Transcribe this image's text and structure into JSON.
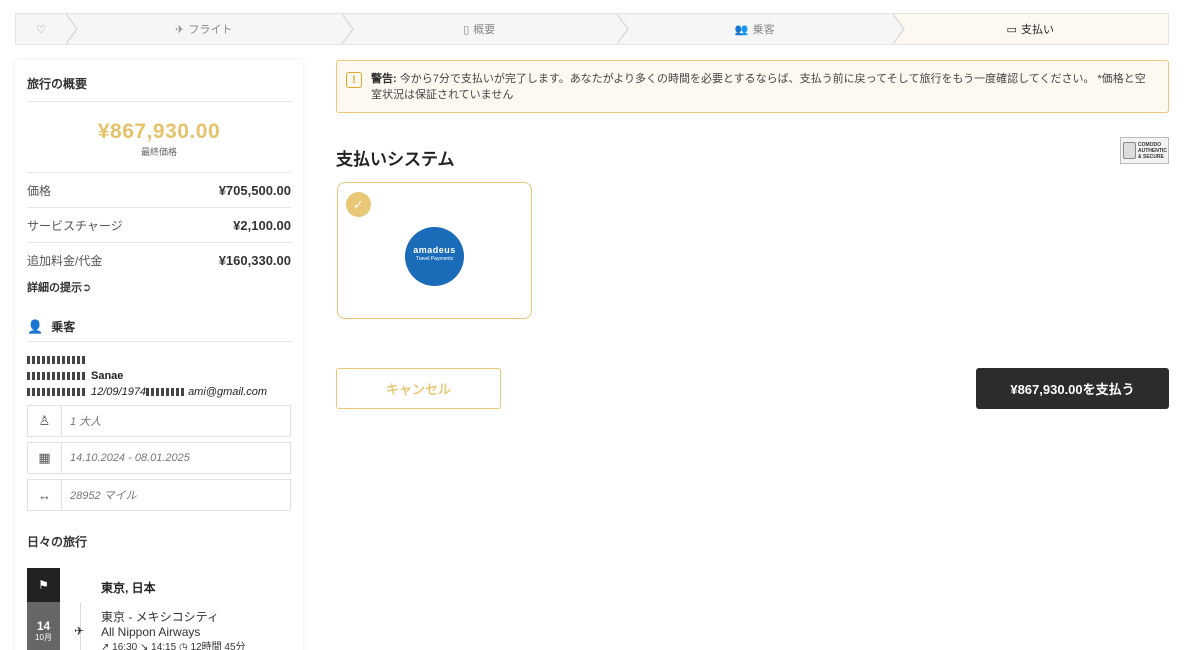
{
  "stepper": {
    "home_icon": "heart-icon",
    "steps": [
      {
        "label": "フライト",
        "icon": "flight-icon"
      },
      {
        "label": "概要",
        "icon": "document-icon"
      },
      {
        "label": "乗客",
        "icon": "users-icon"
      },
      {
        "label": "支払い",
        "icon": "credit-card-icon"
      }
    ],
    "active_step": 3
  },
  "summary": {
    "title": "旅行の概要",
    "total_amount": "¥867,930.00",
    "total_label": "最終価格",
    "rows": [
      {
        "label": "価格",
        "value": "¥705,500.00"
      },
      {
        "label": "サービスチャージ",
        "value": "¥2,100.00"
      },
      {
        "label": "追加料金/代金",
        "value": "¥160,330.00"
      }
    ],
    "details_link": "詳細の提示"
  },
  "passengers": {
    "title": "乗客",
    "name": "Sanae",
    "birth_date": "12/09/1974",
    "email_suffix": "ami@gmail.com",
    "count": "1 大人",
    "dates": "14.10.2024 - 08.01.2025",
    "distance": "28952 マイル"
  },
  "daily": {
    "title": "日々の旅行",
    "city": "東京, 日本",
    "day": "14",
    "month": "10月",
    "route": "東京 - メキシコシティ",
    "airline": "All Nippon Airways",
    "depart": "16:30",
    "arrive": "14:15",
    "duration": "12時間 45分"
  },
  "warning": {
    "label": "警告:",
    "text": "今から7分で支払いが完了します。あなたがより多くの時間を必要とするならば、支払う前に戻ってそして旅行をもう一度確認してください。 *価格と空室状況は保証されていません"
  },
  "payment": {
    "title": "支払いシステム",
    "badge_lines": [
      "COMODO",
      "AUTHENTIC",
      "& SECURE"
    ],
    "provider_name": "amadeus",
    "provider_sub": "Travel Payments"
  },
  "actions": {
    "cancel": "キャンセル",
    "pay": "¥867,930.00を支払う"
  },
  "colors": {
    "accent": "#e8c877",
    "dark": "#2c2c2c",
    "amadeus_blue": "#1a6bb8"
  }
}
